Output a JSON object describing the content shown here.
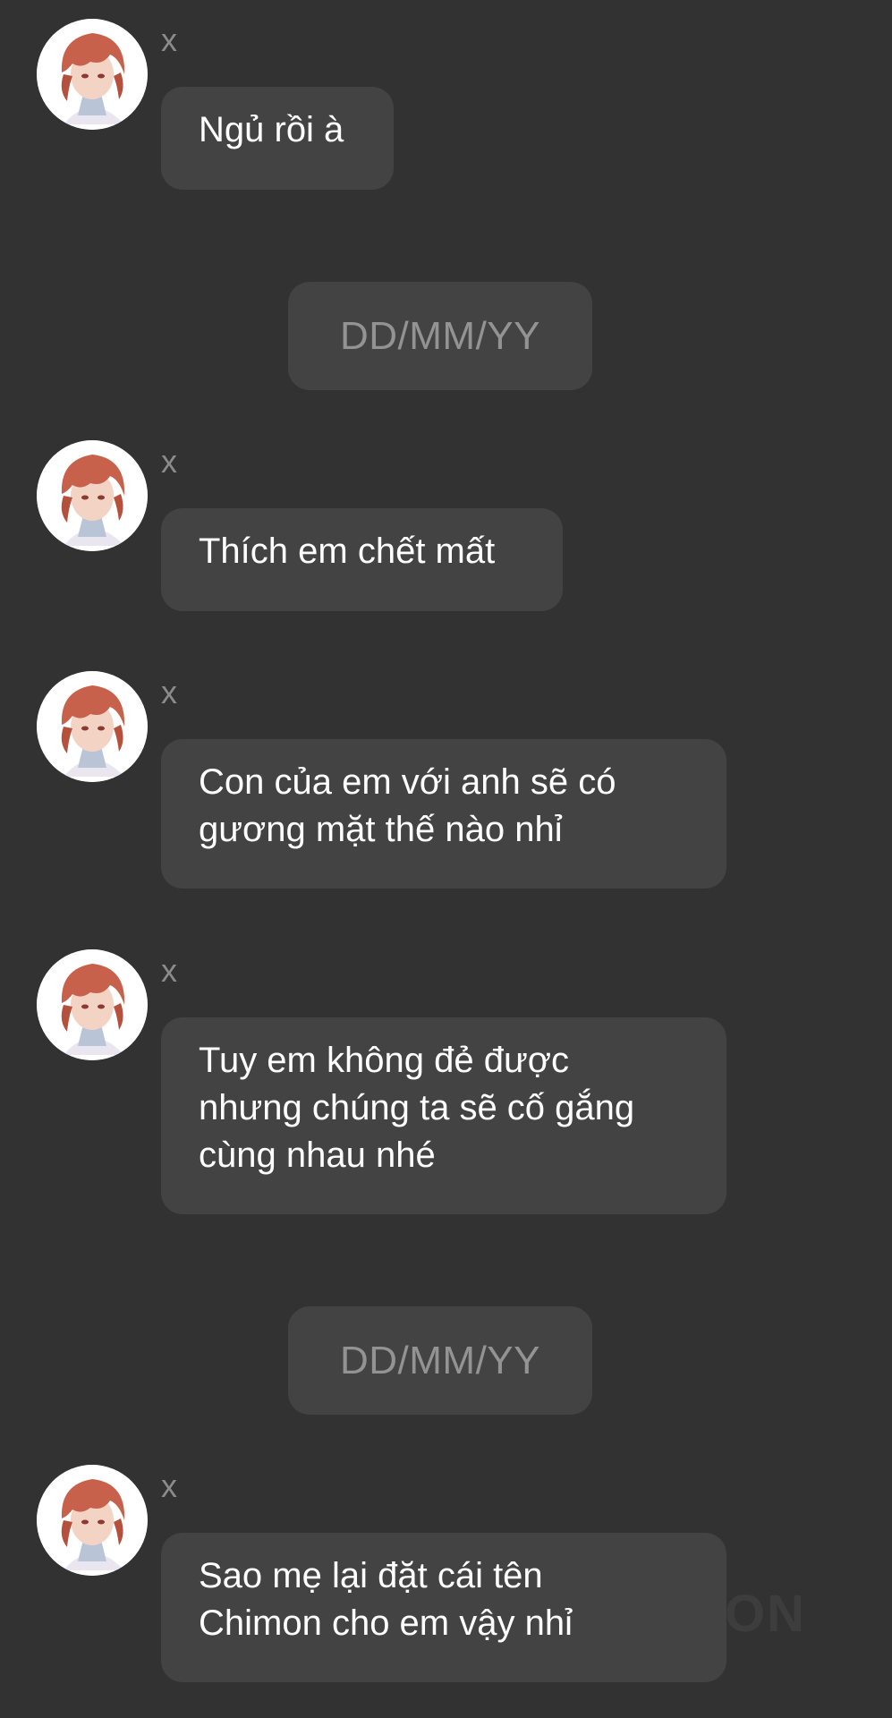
{
  "conversation": {
    "messages": [
      {
        "sender": "x",
        "lines": [
          "Ngủ rồi à"
        ]
      },
      {
        "sender": "x",
        "lines": [
          "Thích em chết mất"
        ]
      },
      {
        "sender": "x",
        "lines": [
          "Con của em với anh sẽ có",
          "gương mặt thế nào nhỉ"
        ]
      },
      {
        "sender": "x",
        "lines": [
          "Tuy em không đẻ được",
          "nhưng chúng ta sẽ cố gắng",
          "cùng nhau nhé"
        ]
      },
      {
        "sender": "x",
        "lines": [
          "Sao mẹ lại đặt cái tên",
          "Chimon cho em vậy nhỉ"
        ]
      }
    ],
    "dates": [
      "DD/MM/YY",
      "DD/MM/YY"
    ]
  },
  "watermark": "ON",
  "colors": {
    "background": "#323232",
    "bubble": "#434343",
    "sender_text": "#8b8b8b",
    "date_text": "#939393"
  }
}
